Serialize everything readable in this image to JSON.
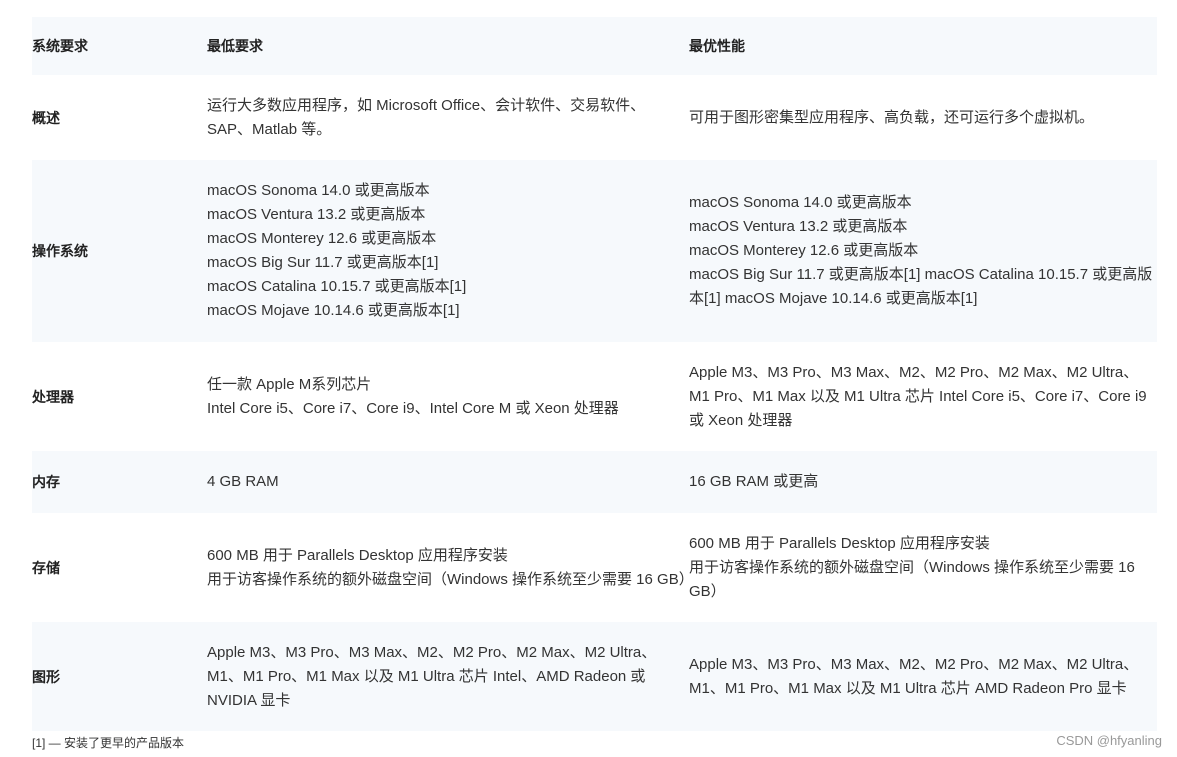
{
  "table": {
    "headers": [
      "系统要求",
      "最低要求",
      "最优性能"
    ],
    "rows": [
      {
        "label": "概述",
        "min": [
          "运行大多数应用程序，如 Microsoft Office、会计软件、交易软件、SAP、Matlab 等。"
        ],
        "best": [
          "可用于图形密集型应用程序、高负载，还可运行多个虚拟机。"
        ]
      },
      {
        "label": "操作系统",
        "min": [
          "macOS Sonoma 14.0 或更高版本",
          "macOS Ventura 13.2 或更高版本",
          "macOS Monterey 12.6 或更高版本",
          "macOS Big Sur 11.7 或更高版本[1]",
          "macOS Catalina 10.15.7 或更高版本[1]",
          "macOS Mojave 10.14.6 或更高版本[1]"
        ],
        "best": [
          "macOS Sonoma 14.0 或更高版本",
          "macOS Ventura 13.2 或更高版本",
          "macOS Monterey 12.6 或更高版本",
          "macOS Big Sur 11.7 或更高版本[1] macOS Catalina 10.15.7 或更高版本[1] macOS Mojave 10.14.6 或更高版本[1]"
        ]
      },
      {
        "label": "处理器",
        "min": [
          "任一款 Apple M系列芯片",
          "Intel Core i5、Core i7、Core i9、Intel Core M 或 Xeon 处理器"
        ],
        "best": [
          "Apple M3、M3 Pro、M3 Max、M2、M2 Pro、M2 Max、M2 Ultra、M1 Pro、M1 Max 以及 M1 Ultra 芯片 Intel Core i5、Core i7、Core i9 或 Xeon 处理器"
        ]
      },
      {
        "label": "内存",
        "min": [
          "4 GB RAM"
        ],
        "best": [
          "16 GB RAM 或更高"
        ]
      },
      {
        "label": "存储",
        "min": [
          "600 MB 用于 Parallels Desktop 应用程序安装",
          "用于访客操作系统的额外磁盘空间（Windows 操作系统至少需要 16 GB）"
        ],
        "best": [
          "600 MB 用于 Parallels Desktop 应用程序安装",
          "用于访客操作系统的额外磁盘空间（Windows 操作系统至少需要 16 GB）"
        ]
      },
      {
        "label": "图形",
        "min": [
          "Apple M3、M3 Pro、M3 Max、M2、M2 Pro、M2 Max、M2 Ultra、M1、M1 Pro、M1 Max 以及 M1 Ultra 芯片 Intel、AMD Radeon 或 NVIDIA 显卡"
        ],
        "best": [
          "Apple M3、M3 Pro、M3 Max、M2、M2 Pro、M2 Max、M2 Ultra、M1、M1 Pro、M1 Max 以及 M1 Ultra 芯片 AMD Radeon Pro 显卡"
        ]
      }
    ]
  },
  "footnote": "[1] — 安装了更早的产品版本",
  "watermark": "CSDN @hfyanling"
}
